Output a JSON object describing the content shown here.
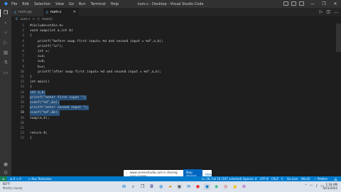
{
  "titlebar": {
    "menu": [
      "File",
      "Edit",
      "Selection",
      "View",
      "Go",
      "Run",
      "Terminal",
      "Help"
    ],
    "title": "num.c - Desktop - Visual Studio Code"
  },
  "tabs": [
    {
      "icon": "C",
      "label": "num.py"
    },
    {
      "icon": "C",
      "label": "num.c"
    }
  ],
  "breadcrumb": {
    "file": "num.c",
    "sep": ">",
    "symbol": "main()"
  },
  "editor": {
    "lines": [
      {
        "n": "1",
        "text": "#include<stdio.h>"
      },
      {
        "n": "2",
        "text": "void swap(int a,int b)"
      },
      {
        "n": "3",
        "text": "{"
      },
      {
        "n": "4",
        "text": "    printf(\"before swap first input= %d and second input = %d\",a,b);"
      },
      {
        "n": "5",
        "text": "    printf(\"\\n\");"
      },
      {
        "n": "6",
        "text": "    int x;"
      },
      {
        "n": "7",
        "text": "    x=a;"
      },
      {
        "n": "8",
        "text": "    a=b;"
      },
      {
        "n": "9",
        "text": "    b=x;"
      },
      {
        "n": "10",
        "text": "    printf(\"after swap first input= %d and second input = %d\",a,b);"
      },
      {
        "n": "11",
        "text": "}"
      },
      {
        "n": "12",
        "text": "int main()"
      },
      {
        "n": "13",
        "text": "{"
      },
      {
        "n": "14",
        "text": "int a,b;"
      },
      {
        "n": "15",
        "text": "printf(\"enter first input \");"
      },
      {
        "n": "16",
        "text": "scanf(\"%d\",&a);"
      },
      {
        "n": "17",
        "text": "printf(\"enter second input \");"
      },
      {
        "n": "18",
        "text": "scanf(\"%d\",&b);"
      },
      {
        "n": "19",
        "text": "swap(a,b);"
      },
      {
        "n": "20",
        "text": ""
      },
      {
        "n": "21",
        "text": ""
      },
      {
        "n": "22",
        "text": "return 0;"
      },
      {
        "n": "23",
        "text": "}"
      }
    ]
  },
  "share_popup": {
    "message": "www.screenstudio.com is sharing your screen.",
    "stop_label": "Stop sharing",
    "hide_label": "Hide"
  },
  "statusbar": {
    "errors": "⊗ 0 ⚠ 0",
    "run": "▷ Run Testcases",
    "position": "Ln 18, Col 16 (107 selected)",
    "spaces": "Spaces: 4",
    "encoding": "UTF-8",
    "eol": "CRLF",
    "language": "C",
    "golive": "Go Live",
    "platform": "Win32",
    "prettier": "✓ Prettier"
  },
  "taskbar": {
    "weather_temp": "83°F",
    "weather_desc": "Mostly cloudy",
    "time": "1:18 AM",
    "date": "4/21/2022"
  },
  "colors": {
    "accent": "#007acc",
    "selection": "#264f78"
  }
}
